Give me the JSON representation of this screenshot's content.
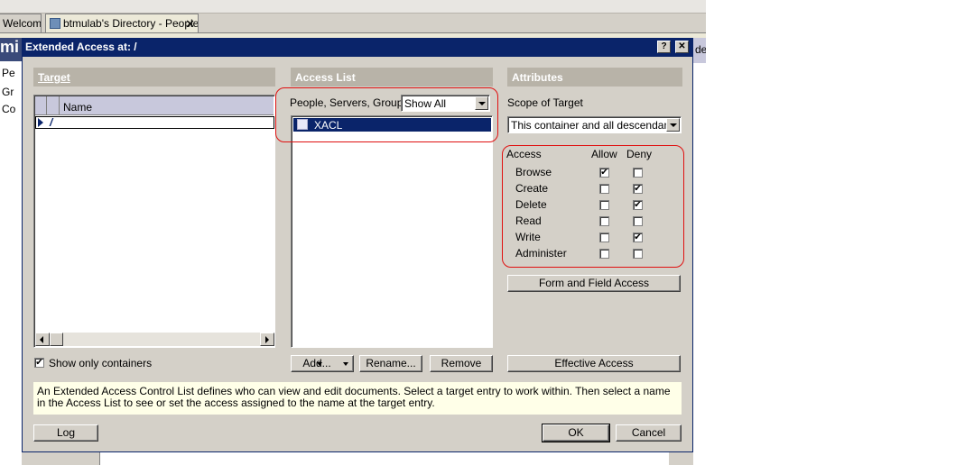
{
  "background": {
    "tabs": [
      {
        "label": "Welcome"
      },
      {
        "label": "btmulab's Directory - People"
      }
    ],
    "sidebar_items": [
      "Pe",
      "Gr",
      "Co"
    ],
    "sidebar_header": "mi",
    "right_header": "de"
  },
  "dialog": {
    "title": "Extended Access at: /",
    "help_label": "?",
    "close_label": "✕",
    "target": {
      "header": "Target",
      "column_name": "Name",
      "row_value": "/",
      "show_only_containers_label": "Show only containers",
      "show_only_containers_checked": true
    },
    "access_list": {
      "header": "Access List",
      "filter_label": "People, Servers, Groups",
      "filter_value": "Show All",
      "items": [
        "XACL"
      ],
      "add_label": "Add...",
      "rename_label": "Rename...",
      "remove_label": "Remove"
    },
    "attributes": {
      "header": "Attributes",
      "scope_label": "Scope of Target",
      "scope_value": "This container and all descendants",
      "col_access": "Access",
      "col_allow": "Allow",
      "col_deny": "Deny",
      "rights": [
        {
          "name": "Browse",
          "allow": true,
          "deny": false
        },
        {
          "name": "Create",
          "allow": false,
          "deny": true
        },
        {
          "name": "Delete",
          "allow": false,
          "deny": true
        },
        {
          "name": "Read",
          "allow": false,
          "deny": false
        },
        {
          "name": "Write",
          "allow": false,
          "deny": true
        },
        {
          "name": "Administer",
          "allow": false,
          "deny": false
        }
      ],
      "form_field_access_label": "Form and Field Access",
      "effective_access_label": "Effective Access"
    },
    "help_text": "An Extended Access Control List defines who can view and edit documents.  Select a target entry to work within.  Then select a name in the Access List to see or set the access assigned to the name at the target entry.",
    "log_label": "Log",
    "ok_label": "OK",
    "cancel_label": "Cancel"
  },
  "colors": {
    "title_bar": "#0a246a",
    "selection": "#0a246a",
    "annotation_ring": "#e01010",
    "dialog_face": "#d4d0c8"
  }
}
